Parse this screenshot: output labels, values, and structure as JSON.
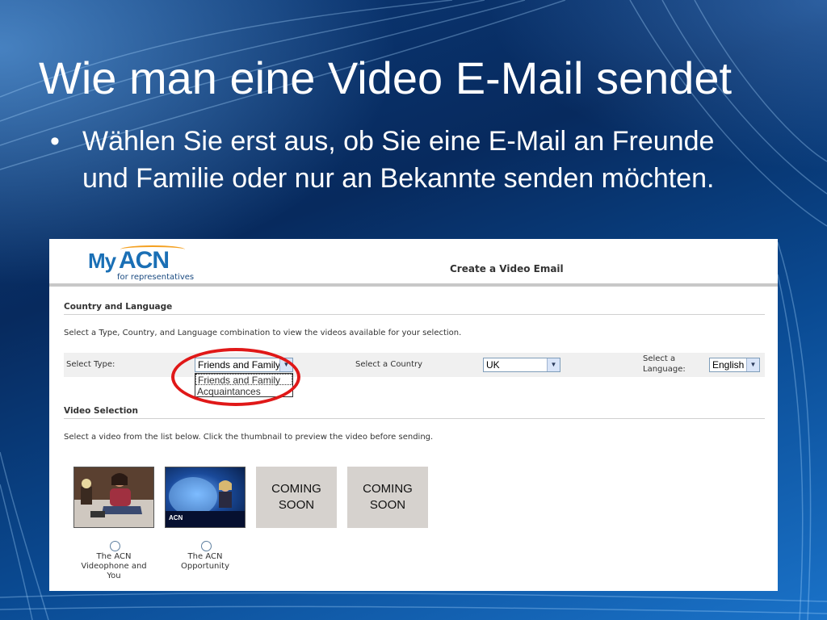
{
  "slide": {
    "title": "Wie man eine Video E-Mail sendet",
    "bullet_char": "•",
    "bullet_text": "Wählen Sie erst aus, ob Sie eine E-Mail an Freunde und Familie oder nur an Bekannte senden möchten."
  },
  "app": {
    "logo_my": "My",
    "logo_acn": "ACN",
    "logo_sub": "for representatives",
    "page_title": "Create a Video Email"
  },
  "country_language": {
    "heading": "Country and Language",
    "description": "Select a Type, Country, and Language combination to view the videos available for your selection.",
    "type_label": "Select Type:",
    "type_value": "Friends and Family",
    "type_options": [
      "Friends and Family",
      "Acquaintances"
    ],
    "country_label": "Select a Country",
    "country_value": "UK",
    "language_label_line1": "Select a",
    "language_label_line2": "Language:",
    "language_value": "English"
  },
  "video_selection": {
    "heading": "Video Selection",
    "description": "Select a video from the list below. Click the thumbnail to preview the video before sending.",
    "videos": [
      {
        "caption": "The ACN Videophone and You"
      },
      {
        "caption": "The ACN Opportunity",
        "thumb_logo": "ACN"
      }
    ],
    "coming_soon_line1": "COMING",
    "coming_soon_line2": "SOON"
  },
  "colors": {
    "highlight_circle": "#e01818",
    "brand_blue": "#1a6fb5"
  }
}
